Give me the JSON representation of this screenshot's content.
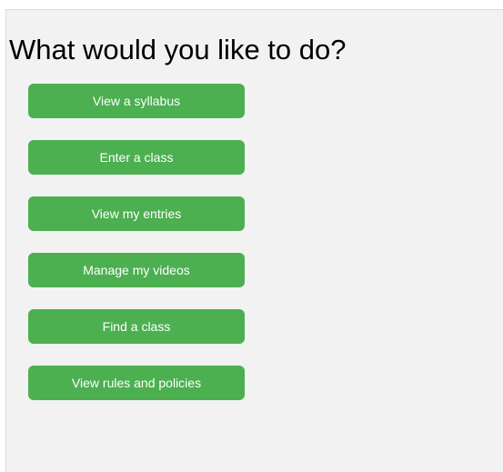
{
  "page": {
    "title": "What would you like to do?"
  },
  "colors": {
    "button_green": "#4caf50",
    "panel_background": "#f2f2f2"
  },
  "menu": {
    "buttons": [
      {
        "label": "View a syllabus"
      },
      {
        "label": "Enter a class"
      },
      {
        "label": "View my entries"
      },
      {
        "label": "Manage my videos"
      },
      {
        "label": "Find a class"
      },
      {
        "label": "View rules and policies"
      }
    ]
  }
}
